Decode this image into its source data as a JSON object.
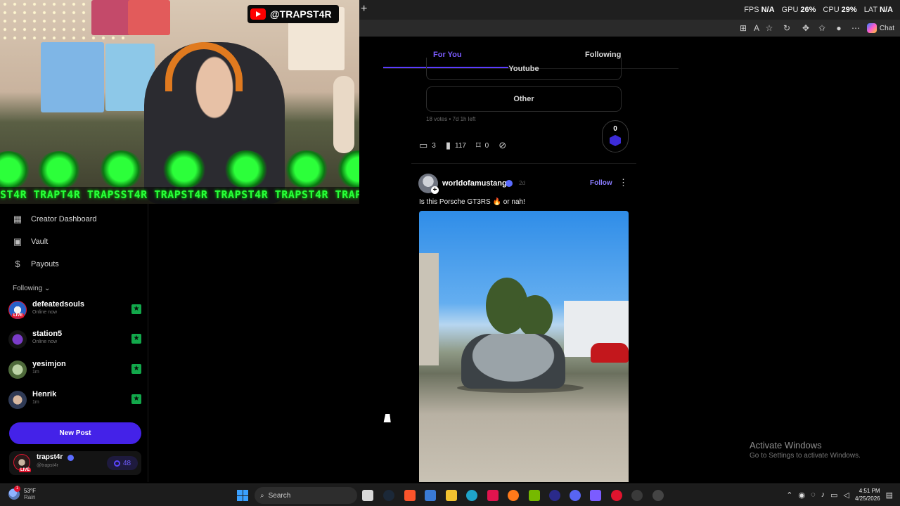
{
  "webcam": {
    "handle": "@TRAPST4R",
    "banner_text": "ST4R TRAPT4R TRAPSST4R TRAPST4R TRAPST4R TRAPST4R TRAPST4R"
  },
  "browser": {
    "perf": {
      "fps_label": "FPS",
      "fps_value": "N/A",
      "gpu_label": "GPU",
      "gpu_value": "26%",
      "cpu_label": "CPU",
      "cpu_value": "29%",
      "lat_label": "LAT",
      "lat_value": "N/A"
    },
    "chat_label": "Chat"
  },
  "feed": {
    "tabs": [
      {
        "label": "For You",
        "active": true
      },
      {
        "label": "Following",
        "active": false
      }
    ]
  },
  "poll_post": {
    "options": [
      "Youtube",
      "Other"
    ],
    "meta": "18 votes • 7d 1h left",
    "comments": "3",
    "views": "117",
    "bookmarks": "0",
    "vote_count": "0"
  },
  "post": {
    "author": "worldofamustang",
    "age": "2d",
    "follow_label": "Follow",
    "text": "Is this Porsche GT3RS 🔥 or nah!"
  },
  "sidebar": {
    "nav": [
      {
        "label": "Creator Dashboard",
        "icon": "dashboard-icon"
      },
      {
        "label": "Vault",
        "icon": "vault-icon"
      },
      {
        "label": "Payouts",
        "icon": "dollar-icon"
      }
    ],
    "following_header": "Following",
    "following": [
      {
        "name": "defeatedsouls",
        "status": "Online now",
        "live": true
      },
      {
        "name": "station5",
        "status": "Online now",
        "live": false
      },
      {
        "name": "yesimjon",
        "status": "1m",
        "live": false
      },
      {
        "name": "Henrik",
        "status": "1m",
        "live": false
      }
    ],
    "new_post_label": "New Post",
    "me": {
      "name": "trapst4r",
      "handle": "@trapst4r",
      "coins": "48",
      "live_tag": "LIVE"
    }
  },
  "watermark": {
    "title": "Activate Windows",
    "subtitle": "Go to Settings to activate Windows."
  },
  "taskbar": {
    "temp": "53°F",
    "condition": "Rain",
    "weather_badge": "1",
    "search_label": "Search",
    "time": "4:51 PM",
    "date": "4/25/2026"
  }
}
